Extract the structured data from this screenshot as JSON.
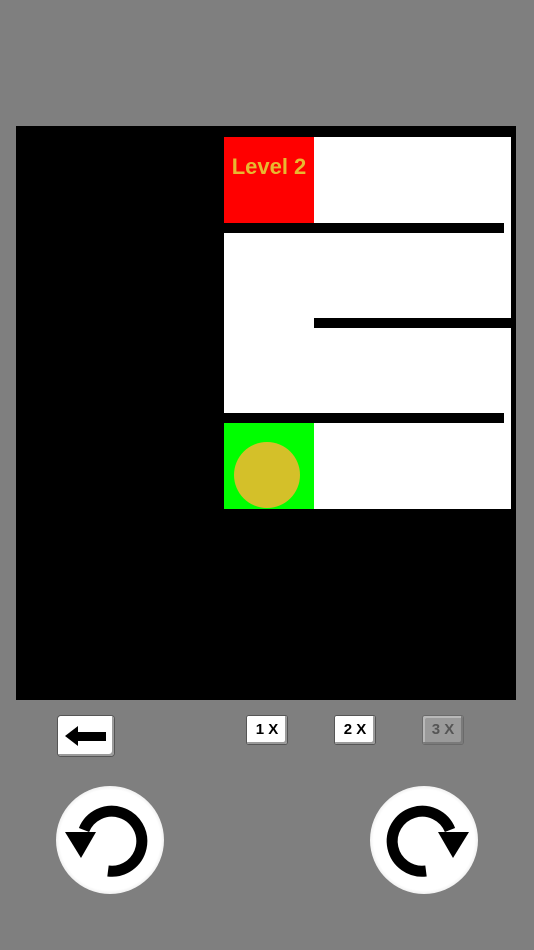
{
  "level": {
    "label": "Level 2"
  },
  "controls": {
    "back_icon": "left-arrow-icon",
    "speeds": [
      {
        "label": "1 X",
        "enabled": true
      },
      {
        "label": "2 X",
        "enabled": true
      },
      {
        "label": "3 X",
        "enabled": false
      }
    ],
    "rotate_left_icon": "rotate-counterclockwise-icon",
    "rotate_right_icon": "rotate-clockwise-icon"
  },
  "colors": {
    "background": "#7f7f7f",
    "board": "#000000",
    "goal": "#ff0000",
    "start": "#00ff00",
    "ball": "#d4c029",
    "level_text": "#e8b830"
  }
}
